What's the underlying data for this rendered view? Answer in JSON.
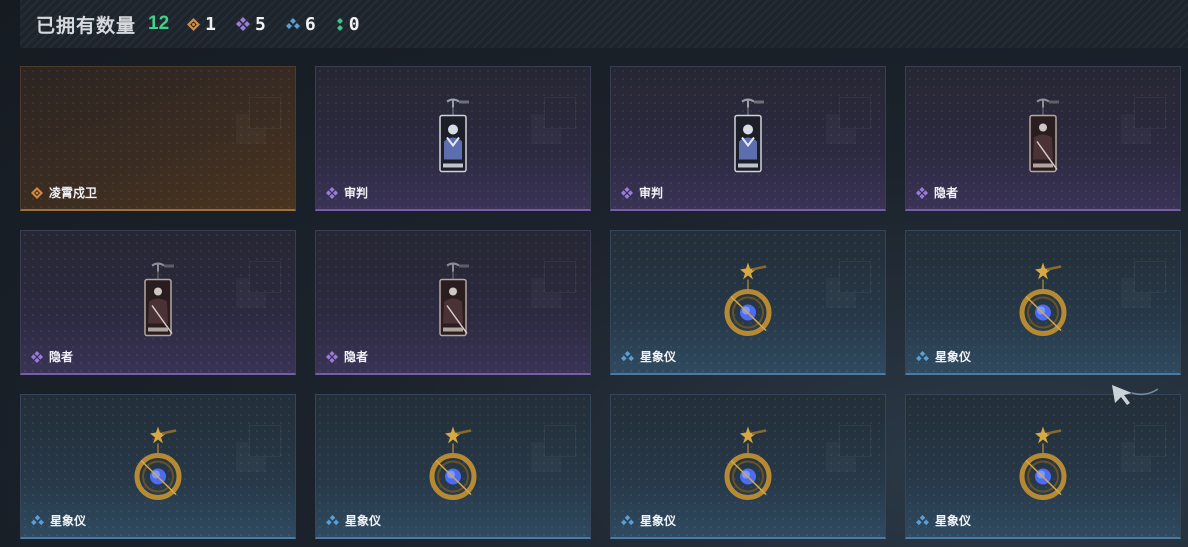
{
  "header": {
    "title": "已拥有数量",
    "total": "12",
    "counts": [
      {
        "icon": "orange-rarity-icon",
        "value": "1"
      },
      {
        "icon": "purple-rarity-icon",
        "value": "5"
      },
      {
        "icon": "blue-rarity-icon",
        "value": "6"
      },
      {
        "icon": "green-rarity-icon",
        "value": "0"
      }
    ]
  },
  "colors": {
    "orange": "#d58a43",
    "purple": "#9a7cdc",
    "blue": "#5aa0d8",
    "green": "#39c98a",
    "total": "#3fd48a"
  },
  "items": [
    {
      "name": "凌霄戍卫",
      "rarity": "orange",
      "art": "none"
    },
    {
      "name": "审判",
      "rarity": "purple",
      "art": "judgement-card-icon"
    },
    {
      "name": "审判",
      "rarity": "purple",
      "art": "judgement-card-icon"
    },
    {
      "name": "隐者",
      "rarity": "purple",
      "art": "hermit-card-icon"
    },
    {
      "name": "隐者",
      "rarity": "purple",
      "art": "hermit-card-icon"
    },
    {
      "name": "隐者",
      "rarity": "purple",
      "art": "hermit-card-icon"
    },
    {
      "name": "星象仪",
      "rarity": "blue",
      "art": "astrolabe-icon"
    },
    {
      "name": "星象仪",
      "rarity": "blue",
      "art": "astrolabe-icon"
    },
    {
      "name": "星象仪",
      "rarity": "blue",
      "art": "astrolabe-icon"
    },
    {
      "name": "星象仪",
      "rarity": "blue",
      "art": "astrolabe-icon"
    },
    {
      "name": "星象仪",
      "rarity": "blue",
      "art": "astrolabe-icon"
    },
    {
      "name": "星象仪",
      "rarity": "blue",
      "art": "astrolabe-icon"
    }
  ]
}
